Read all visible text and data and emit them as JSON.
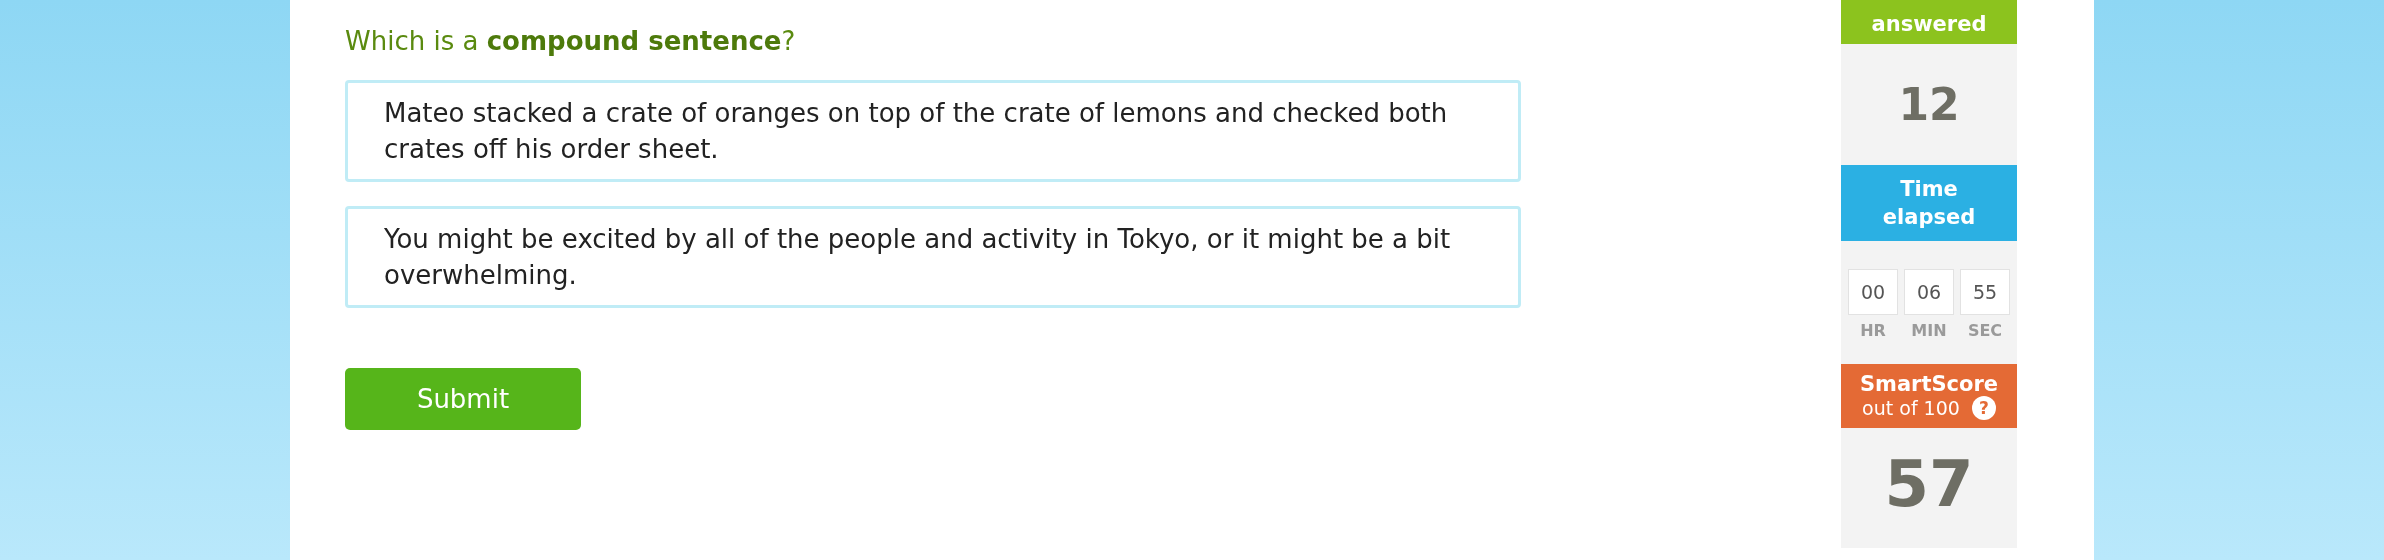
{
  "question": "Which is a **compound sentence**?",
  "choices": [
    {
      "text": "Mateo stacked a crate of oranges on top of the crate of lemons and checked both crates off his order sheet.",
      "selected": false
    },
    {
      "text": "You might be excited by all of the people and activity in Tokyo, or it might be a bit overwhelming.",
      "selected": false
    }
  ],
  "submit": "Submit",
  "questions_answered": {
    "label": "answered",
    "value": "12"
  },
  "time_elapsed": {
    "label": "Time elapsed",
    "parts": [
      {
        "value": "00",
        "unit": "HR"
      },
      {
        "value": "06",
        "unit": "MIN"
      },
      {
        "value": "55",
        "unit": "SEC"
      }
    ]
  },
  "smartscore": {
    "label": "SmartScore",
    "sublabel": "out of 100",
    "help": "?",
    "value": "57"
  }
}
